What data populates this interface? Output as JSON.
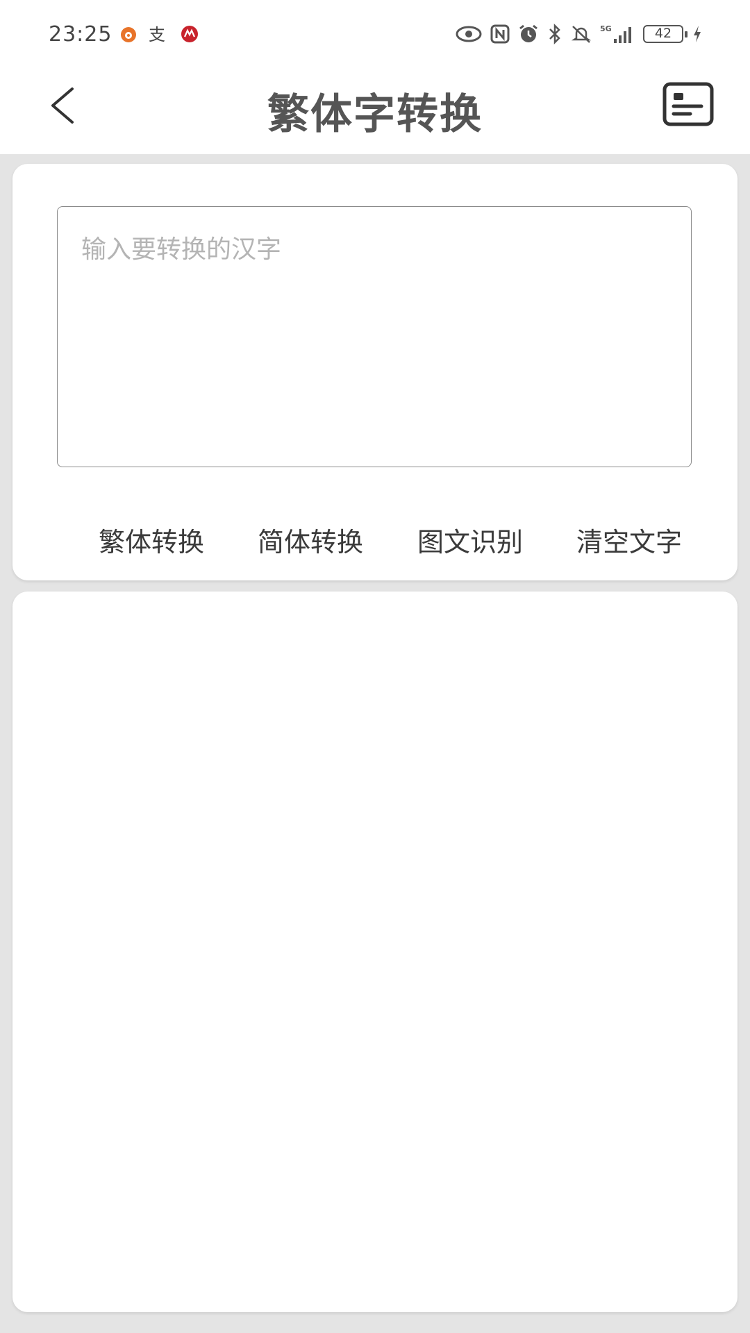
{
  "status_bar": {
    "time": "23:25",
    "battery": "42",
    "network": "5G",
    "notification_icons": [
      "weibo-icon",
      "alipay-icon",
      "cmb-bank-icon"
    ],
    "system_icons": [
      "eye-icon",
      "nfc-icon",
      "alarm-icon",
      "bluetooth-icon",
      "mute-icon",
      "signal-icon",
      "charging-icon"
    ]
  },
  "header": {
    "title": "繁体字转换"
  },
  "input": {
    "placeholder": "输入要转换的汉字",
    "value": ""
  },
  "actions": {
    "traditional": "繁体转换",
    "simplified": "简体转换",
    "ocr": "图文识别",
    "clear": "清空文字"
  },
  "colors": {
    "background": "#e4e4e4",
    "card": "#ffffff",
    "title": "#555555",
    "placeholder": "#b4b4b4"
  }
}
